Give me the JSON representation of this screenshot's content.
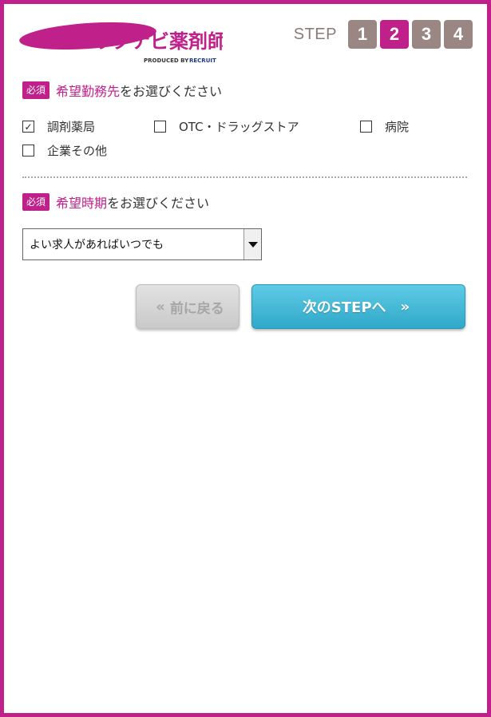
{
  "header": {
    "logo_text": "リクナビ薬剤師",
    "logo_sub": "PRODUCED BY",
    "logo_brand": "RECRUIT",
    "step_label": "STEP",
    "steps": [
      "1",
      "2",
      "3",
      "4"
    ],
    "active_step": "2"
  },
  "workplace": {
    "required_badge": "必須",
    "title_accent": "希望勤務先",
    "title_rest": "をお選びください",
    "options": [
      {
        "label": "調剤薬局",
        "checked": true
      },
      {
        "label": "OTC・ドラッグストア",
        "checked": false
      },
      {
        "label": "病院",
        "checked": false
      },
      {
        "label": "企業その他",
        "checked": false
      }
    ]
  },
  "timing": {
    "required_badge": "必須",
    "title_accent": "希望時期",
    "title_rest": "をお選びください",
    "selected": "よい求人があればいつでも"
  },
  "buttons": {
    "back": "前に戻る",
    "next": "次のSTEPへ"
  },
  "colors": {
    "brand": "#c0208a",
    "step_inactive": "#9a8683",
    "next_button": "#3fb6d6"
  }
}
